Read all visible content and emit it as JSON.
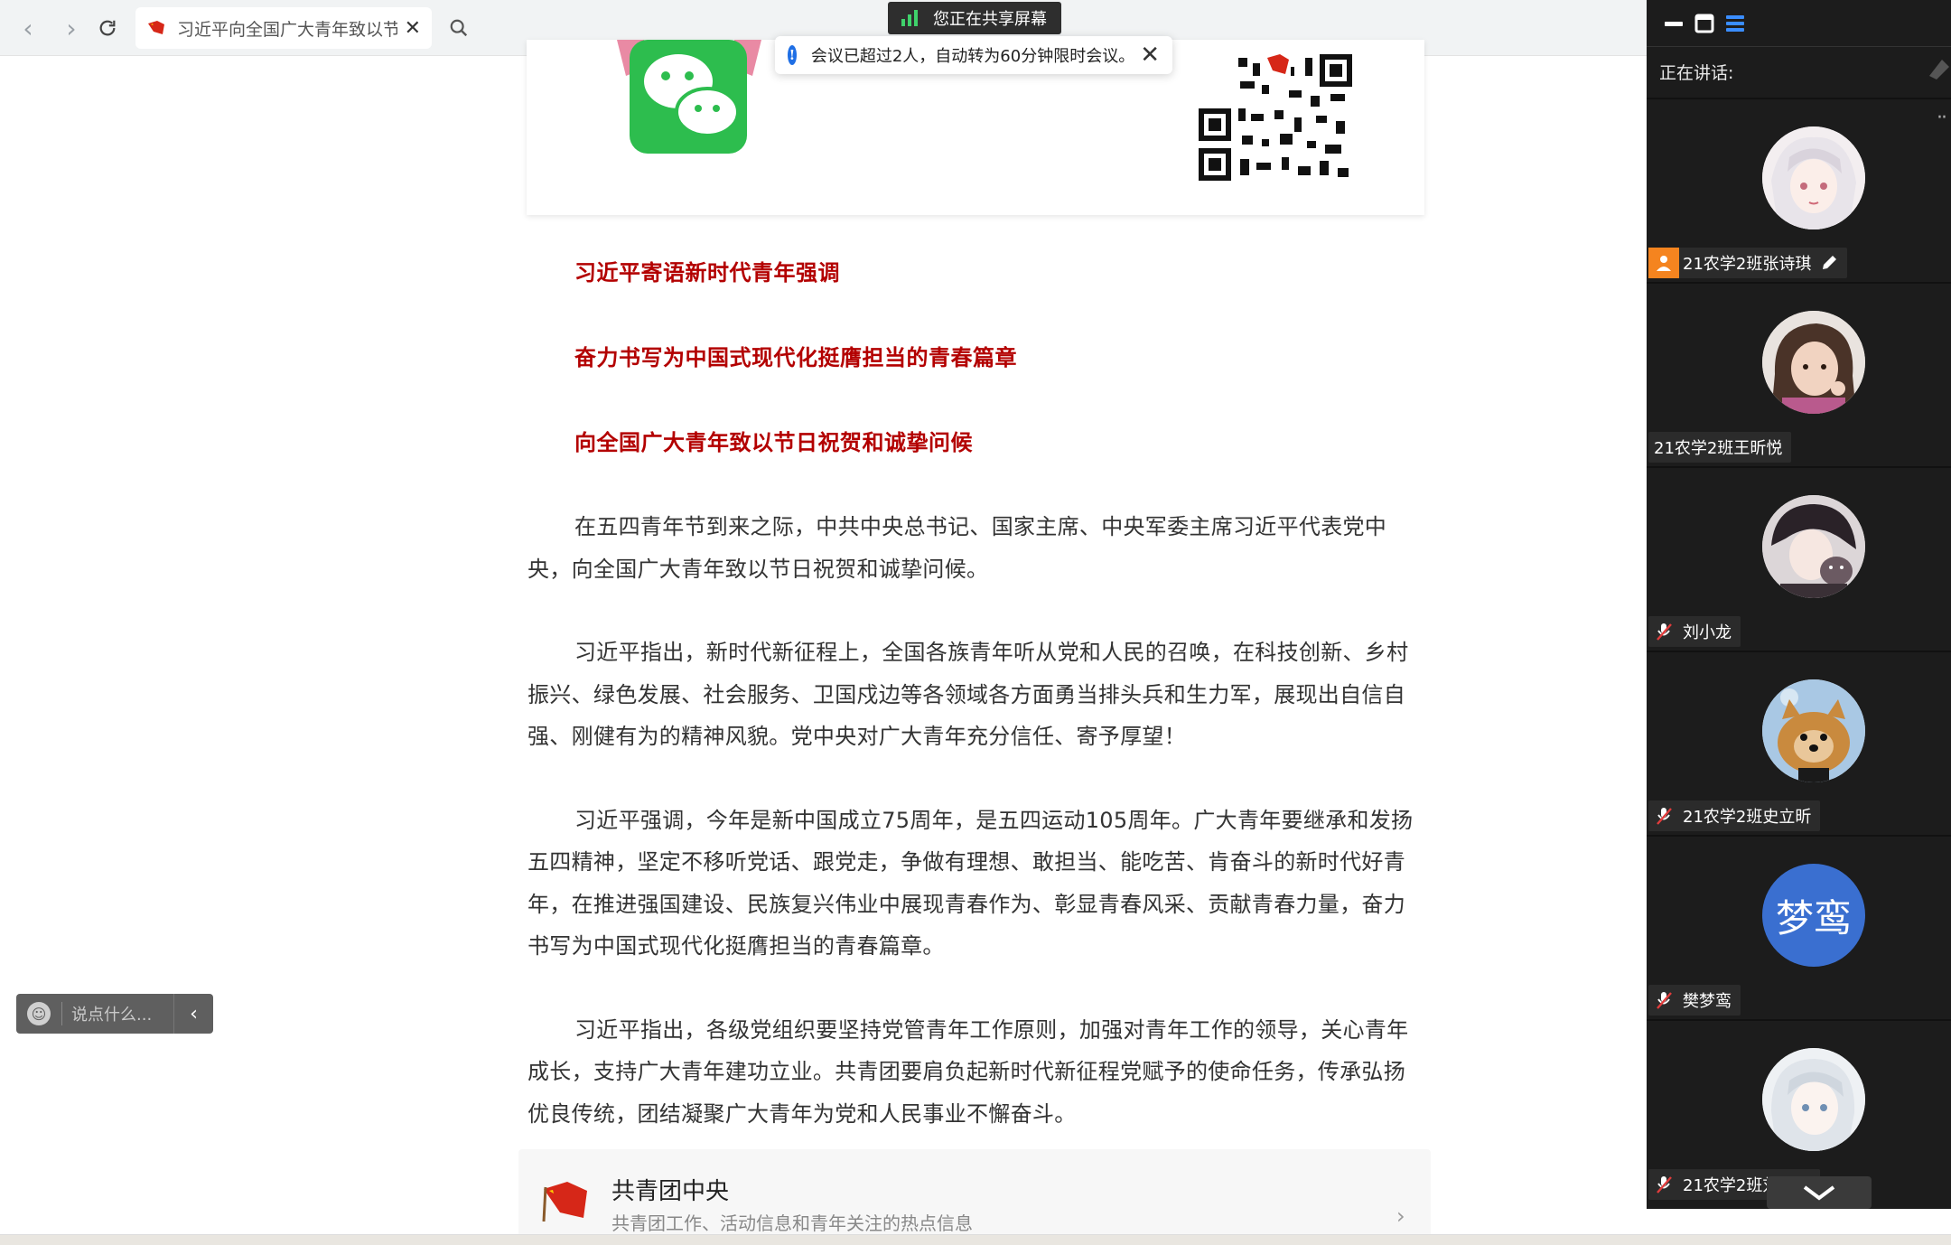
{
  "browser": {
    "tab_title": "习近平向全国广大青年致以节"
  },
  "share": {
    "label": "您正在共享屏幕"
  },
  "toast": {
    "message": "会议已超过2人，自动转为60分钟限时会议。"
  },
  "article": {
    "headings": [
      "习近平寄语新时代青年强调",
      "奋力书写为中国式现代化挺膺担当的青春篇章",
      "向全国广大青年致以节日祝贺和诚挚问候"
    ],
    "paragraphs": [
      "在五四青年节到来之际，中共中央总书记、国家主席、中央军委主席习近平代表党中央，向全国广大青年致以节日祝贺和诚挚问候。",
      "习近平指出，新时代新征程上，全国各族青年听从党和人民的召唤，在科技创新、乡村振兴、绿色发展、社会服务、卫国戍边等各领域各方面勇当排头兵和生力军，展现出自信自强、刚健有为的精神风貌。党中央对广大青年充分信任、寄予厚望！",
      "习近平强调，今年是新中国成立75周年，是五四运动105周年。广大青年要继承和发扬五四精神，坚定不移听党话、跟党走，争做有理想、敢担当、能吃苦、肯奋斗的新时代好青年，在推进强国建设、民族复兴伟业中展现青春作为、彰显青春风采、贡献青春力量，奋力书写为中国式现代化挺膺担当的青春篇章。",
      "习近平指出，各级党组织要坚持党管青年工作原则，加强对青年工作的领导，关心青年成长，支持广大青年建功立业。共青团要肩负起新时代新征程党赋予的使命任务，传承弘扬优良传统，团结凝聚广大青年为党和人民事业不懈奋斗。"
    ],
    "source": {
      "name": "共青团中央",
      "desc": "共青团工作、活动信息和青年关注的热点信息"
    }
  },
  "chat": {
    "placeholder": "说点什么..."
  },
  "panel": {
    "speaking_label": "正在讲话:",
    "participants": [
      {
        "name": "21农学2班张诗琪",
        "role": "host",
        "avatar": "anime-girl"
      },
      {
        "name": "21农学2班王昕悦",
        "role": "member",
        "avatar": "child-photo"
      },
      {
        "name": "刘小龙",
        "role": "muted",
        "avatar": "anime-boy-cat"
      },
      {
        "name": "21农学2班史立昕",
        "role": "muted",
        "avatar": "pomeranian-dog"
      },
      {
        "name": "樊梦鸾",
        "role": "muted",
        "avatar": "text",
        "avatar_text": "梦鸾"
      },
      {
        "name": "21农学2班刘宇法",
        "role": "muted",
        "avatar": "anime-white-hair"
      }
    ]
  },
  "colors": {
    "heading_red": "#b30000",
    "panel_bg": "#1c1c1c",
    "host_orange": "#f5841f",
    "avatar_blue": "#3a6fd0"
  }
}
